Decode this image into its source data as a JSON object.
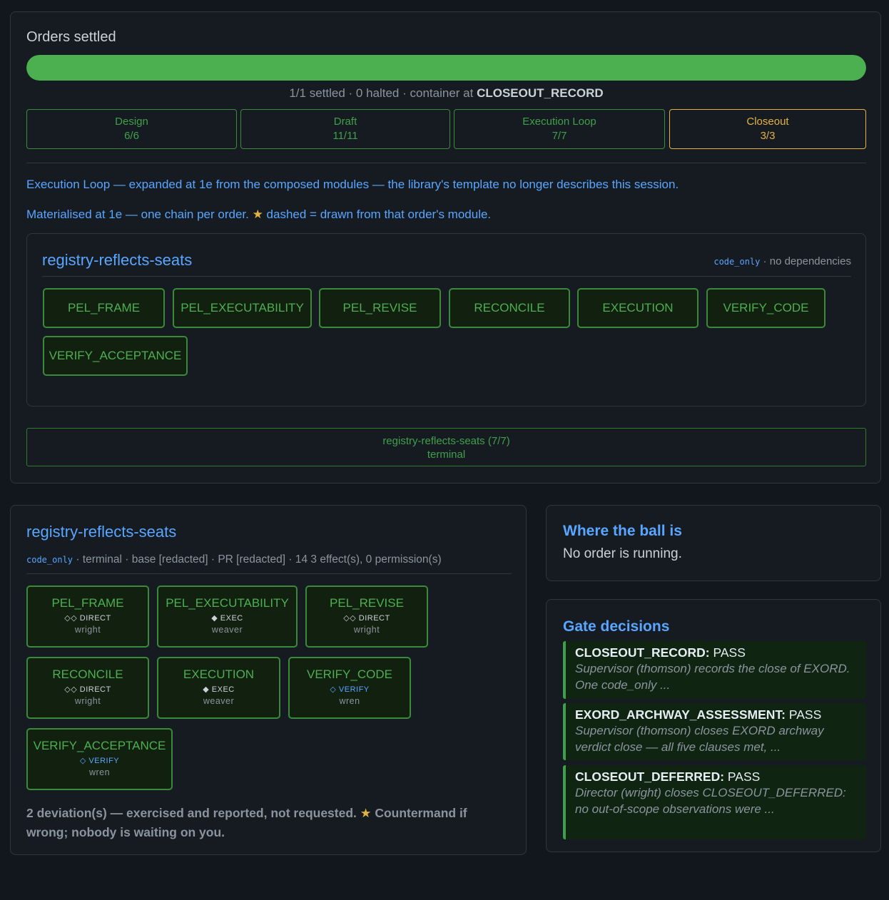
{
  "orders": {
    "label": "Orders settled",
    "progress": 1.0,
    "summary_prefix": "1/1 settled · 0 halted · container at ",
    "summary_container": "CLOSEOUT_RECORD",
    "phases": [
      {
        "name": "Design",
        "count": "6/6"
      },
      {
        "name": "Draft",
        "count": "11/11"
      },
      {
        "name": "Execution Loop",
        "count": "7/7"
      },
      {
        "name": "Closeout",
        "count": "3/3"
      }
    ],
    "note_1": "Execution Loop — expanded at 1e from the composed modules — the library's template no longer describes this session.",
    "note_2_before": "Materialised at 1e — one chain per order. ",
    "note_2_after": " dashed = drawn from that order's module.",
    "star": "★"
  },
  "chain": {
    "title": "registry-reflects-seats",
    "meta_tag": "code_only",
    "meta_rest": " · no dependencies",
    "nodes": [
      "PEL_FRAME",
      "PEL_EXECUTABILITY",
      "PEL_REVISE",
      "RECONCILE",
      "EXECUTION",
      "VERIFY_CODE",
      "VERIFY_ACCEPTANCE"
    ],
    "terminal_line1": "registry-reflects-seats (7/7)",
    "terminal_line2": "terminal"
  },
  "detail": {
    "title": "registry-reflects-seats",
    "meta_tag": "code_only",
    "meta_rest": " · terminal · base [redacted] · PR [redacted] · 14 3 effect(s), 0 permission(s)",
    "cards": [
      {
        "name": "PEL_FRAME",
        "kind": "◇◇ DIRECT",
        "who": "wright"
      },
      {
        "name": "PEL_EXECUTABILITY",
        "kind": "◆ EXEC",
        "who": "weaver"
      },
      {
        "name": "PEL_REVISE",
        "kind": "◇◇ DIRECT",
        "who": "wright"
      },
      {
        "name": "RECONCILE",
        "kind": "◇◇ DIRECT",
        "who": "wright"
      },
      {
        "name": "EXECUTION",
        "kind": "◆ EXEC",
        "who": "weaver"
      },
      {
        "name": "VERIFY_CODE",
        "kind": "◇ VERIFY",
        "who": "wren"
      },
      {
        "name": "VERIFY_ACCEPTANCE",
        "kind": "◇ VERIFY",
        "who": "wren"
      }
    ],
    "deviation_before": "2 deviation(s) — exercised and reported, not requested. ",
    "deviation_after": " Countermand if wrong; nobody is waiting on you."
  },
  "ball": {
    "title": "Where the ball is",
    "text": "No order is running."
  },
  "gates": {
    "title": "Gate decisions",
    "items": [
      {
        "gate": "CLOSEOUT_RECORD:",
        "result": " PASS",
        "desc": "Supervisor (thomson) records the close of EXORD. One code_only ..."
      },
      {
        "gate": "EXORD_ARCHWAY_ASSESSMENT:",
        "result": " PASS",
        "desc": "Supervisor (thomson) closes EXORD archway verdict close — all five clauses met, ..."
      },
      {
        "gate": "CLOSEOUT_DEFERRED:",
        "result": " PASS",
        "desc": "Director (wright) closes CLOSEOUT_DEFERRED: no out-of-scope observations were ..."
      }
    ]
  },
  "colors": {
    "accent": "#58a6ff",
    "success": "#4caf50",
    "active_phase": "#e3b341",
    "background": "#12161d"
  }
}
